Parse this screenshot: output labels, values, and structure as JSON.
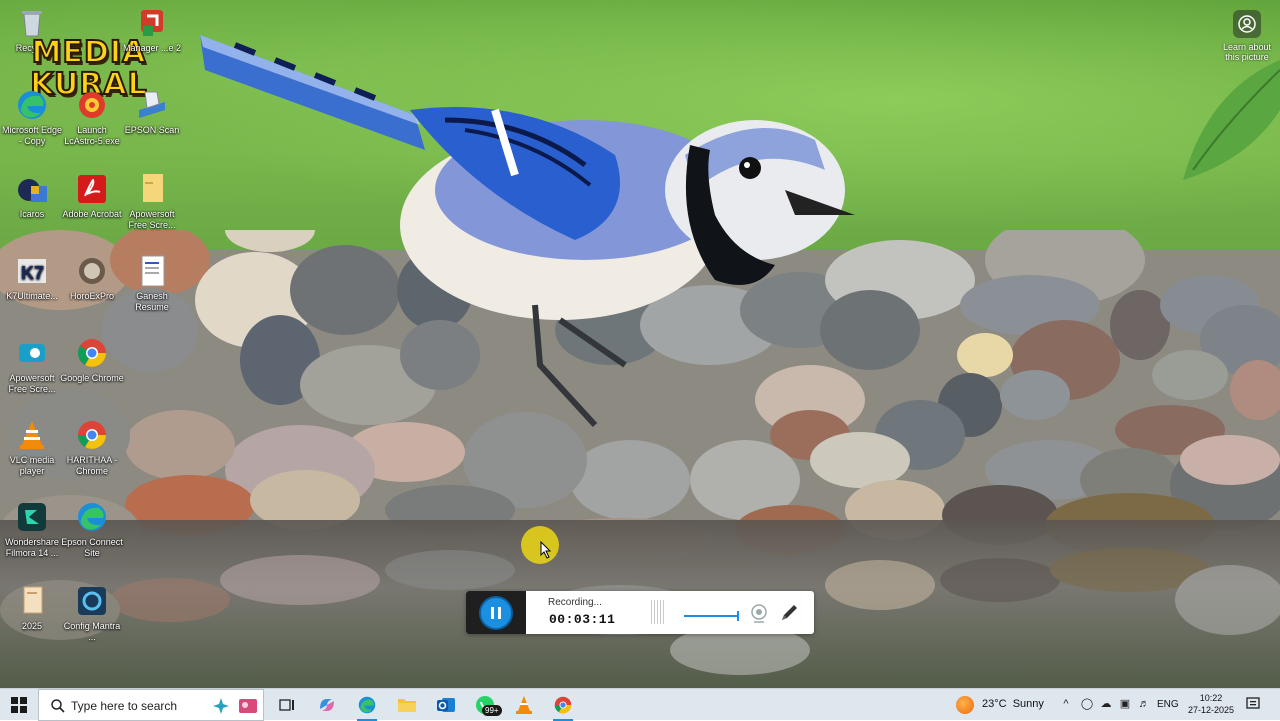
{
  "desktop": {
    "logo": {
      "line1": "MEDIA",
      "line2": "KURAL"
    },
    "learn_label": "Learn about this picture",
    "icons": [
      {
        "id": "recycle",
        "label": "Recyc..."
      },
      {
        "id": "manager",
        "label": "Manager ...e 2"
      },
      {
        "id": "edge-copy",
        "label": "Microsoft Edge - Copy"
      },
      {
        "id": "lcastro",
        "label": "Launch LcAstro-5.exe"
      },
      {
        "id": "epson-scan",
        "label": "EPSON Scan"
      },
      {
        "id": "icaros",
        "label": "Icaros"
      },
      {
        "id": "acrobat",
        "label": "Adobe Acrobat"
      },
      {
        "id": "apowersoft-1",
        "label": "Apowersoft Free Scre..."
      },
      {
        "id": "k7",
        "label": "K7Ultimate..."
      },
      {
        "id": "horoexpro",
        "label": "HoroExPro"
      },
      {
        "id": "ganesh",
        "label": "Ganesh Resume"
      },
      {
        "id": "apowersoft-2",
        "label": "Apowersoft Free Scre..."
      },
      {
        "id": "chrome",
        "label": "Google Chrome"
      },
      {
        "id": "vlc",
        "label": "VLC media player"
      },
      {
        "id": "haritha",
        "label": "HARITHAA - Chrome"
      },
      {
        "id": "filmora",
        "label": "Wondershare Filmora 14 ..."
      },
      {
        "id": "epson-connect",
        "label": "Epson Connect Site"
      },
      {
        "id": "folder-2025",
        "label": "2025"
      },
      {
        "id": "config",
        "label": "Config Mantra ..."
      }
    ]
  },
  "recorder": {
    "status": "Recording...",
    "time": "00:03:11",
    "volume_level": 0.9
  },
  "taskbar": {
    "search_placeholder": "Type here to search",
    "whatsapp_badge": "99+",
    "weather": {
      "temp": "23°C",
      "condition": "Sunny"
    },
    "language": "ENG",
    "time": "10:22",
    "date": "27-12-2025"
  },
  "colors": {
    "accent": "#1c8fe0",
    "taskbar": "#dfe7ee",
    "logo": "#ffd21a"
  }
}
